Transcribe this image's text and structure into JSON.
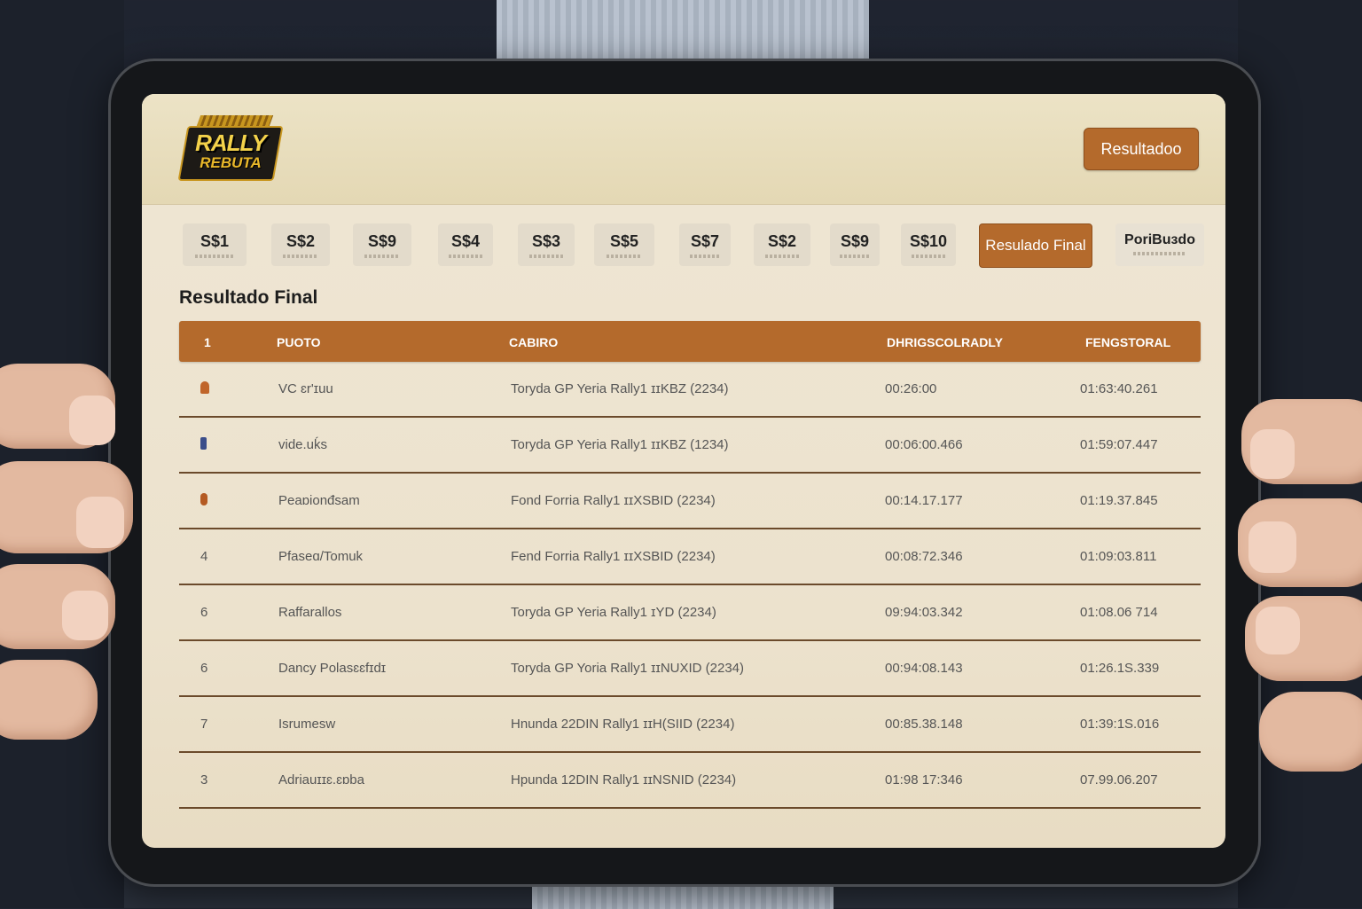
{
  "header": {
    "logo_line1": "RALLY",
    "logo_line2": "REBUTA",
    "button_label": "Resultadoo"
  },
  "tabs": [
    {
      "label": "S$1"
    },
    {
      "label": "S$2"
    },
    {
      "label": "S$9"
    },
    {
      "label": "S$4"
    },
    {
      "label": "S$3"
    },
    {
      "label": "S$5"
    },
    {
      "label": "S$7"
    },
    {
      "label": "S$2"
    },
    {
      "label": "S$9"
    },
    {
      "label": "S$10"
    },
    {
      "label": "Resulado Final",
      "active": true
    },
    {
      "label": "PoriBuɜdo"
    }
  ],
  "section_title": "Resultado Final",
  "table": {
    "headers": [
      "1",
      "PUOTO",
      "CABIRO",
      "DHRIGSCOLRADLY",
      "FENGSTORAL"
    ],
    "rows": [
      {
        "pos": "",
        "pos_icon": "trophy-icon",
        "name": "VC ɛr'ɪuu",
        "car": "Toryda GP Yeria Rally1 ɪɪKBZ (2234)",
        "t1": "00:26:00",
        "t2": "01:63:40.261"
      },
      {
        "pos": "",
        "pos_icon": "medal-icon",
        "name": "vide.uḱs",
        "car": "Toryda GP Yeria Rally1 ɪɪKBZ (1234)",
        "t1": "00:06:00.466",
        "t2": "01:59:07.447"
      },
      {
        "pos": "",
        "pos_icon": "medal-icon",
        "name": "Peaɒionđsam",
        "car": "Fond Forria Rally1 ɪɪXSBID (2234)",
        "t1": "00:14.17.177",
        "t2": "01:19.37.845"
      },
      {
        "pos": "4",
        "name": "Pfaseɑ/Tomuk",
        "car": "Fend Forria Rally1 ɪɪXSBID (2234)",
        "t1": "00:08:72.346",
        "t2": "01:09:03.811"
      },
      {
        "pos": "6",
        "name": "Raffarallos",
        "car": "Toryda GP Yeria Rally1 ɪYD (2234)",
        "t1": "09:94:03.342",
        "t2": "01:08.06 714"
      },
      {
        "pos": "6",
        "name": "Dancy Polasɛɛfɪdɪ",
        "car": "Toryda GP Yoria Rally1 ɪɪNUXID (2234)",
        "t1": "00:94:08.143",
        "t2": "01:26.1S.339"
      },
      {
        "pos": "7",
        "name": "Isrumesw",
        "car": "Hnunda 22DIN Rally1 ɪɪH(SIID (2234)",
        "t1": "00:85.38.148",
        "t2": "01:39:1S.016"
      },
      {
        "pos": "3",
        "name": "Adriauɪɪɛ.ɛɒba",
        "car": "Hpunda 12DIN Rally1 ɪɪNSNID (2234)",
        "t1": "01:98 17:346",
        "t2": "07.99.06.207"
      }
    ]
  },
  "colors": {
    "accent": "#b46a2c",
    "screen_bg": "#ece2cd",
    "row_divider": "#6b4a2b"
  }
}
